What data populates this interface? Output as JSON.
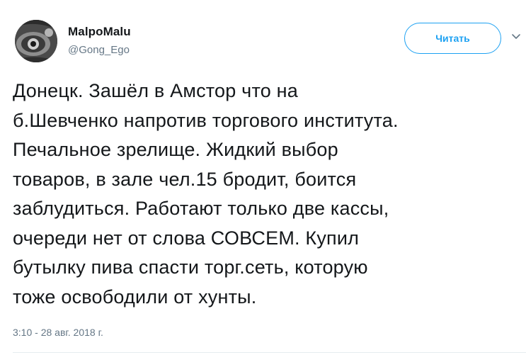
{
  "user": {
    "display_name": "MalpoMalu",
    "handle": "@Gong_Ego"
  },
  "follow_button": {
    "label": "Читать"
  },
  "tweet": {
    "lines": [
      "Донецк. Зашёл в Амстор что на",
      "б.Шевченко напротив торгового института.",
      "Печальное зрелище. Жидкий выбор",
      "товаров, в зале чел.15 бродит, боится",
      "заблудиться. Работают только две кассы,",
      "очереди нет от слова СОВСЕМ. Купил",
      "бутылку пива спасти торг.сеть, которую",
      "тоже освободили от хунты."
    ],
    "timestamp": "3:10 - 28 авг. 2018 г."
  },
  "icons": {
    "menu": "chevron-down-icon"
  },
  "colors": {
    "accent": "#1da1f2",
    "text": "#14171a",
    "muted": "#657786"
  }
}
